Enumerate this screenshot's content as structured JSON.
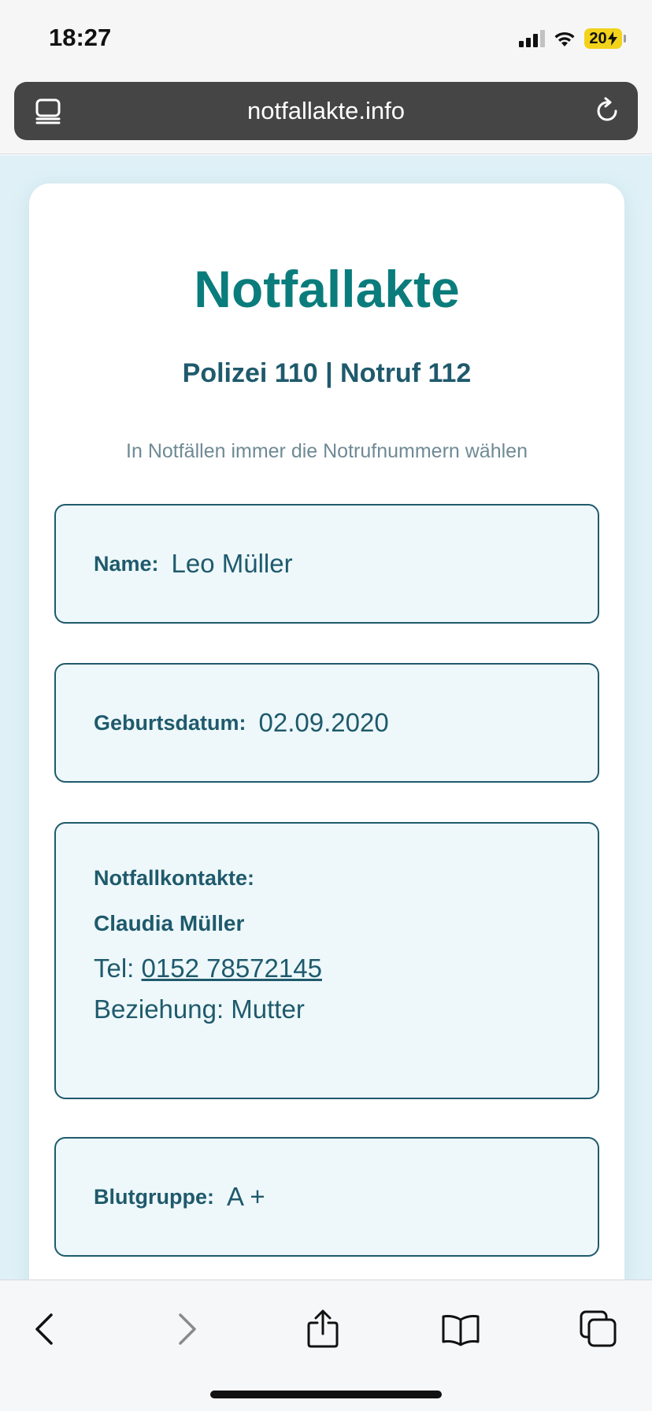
{
  "status_bar": {
    "time": "18:27",
    "battery": "20"
  },
  "browser": {
    "url": "notfallakte.info"
  },
  "page": {
    "title": "Notfallakte",
    "emergency_numbers": "Polizei 110 | Notruf 112",
    "hint": "In Notfällen immer die Notrufnummern wählen",
    "name": {
      "label": "Name:",
      "value": "Leo Müller"
    },
    "birthdate": {
      "label": "Geburtsdatum:",
      "value": "02.09.2020"
    },
    "contacts": {
      "label": "Notfallkontakte:",
      "name": "Claudia Müller",
      "phone_prefix": "Tel: ",
      "phone": "0152 78572145",
      "relation": "Beziehung: Mutter"
    },
    "blood_group": {
      "label": "Blutgruppe:",
      "value": "A +"
    }
  },
  "colors": {
    "accent": "#0b7c7c",
    "text": "#1f5a6c",
    "page_bg": "#dff1f7",
    "box_bg": "#eef8fb"
  },
  "icons": {
    "url_left": "reader-icon",
    "url_right": "reload-icon",
    "toolbar": [
      "back-icon",
      "forward-icon",
      "share-icon",
      "bookmarks-icon",
      "tabs-icon"
    ]
  }
}
